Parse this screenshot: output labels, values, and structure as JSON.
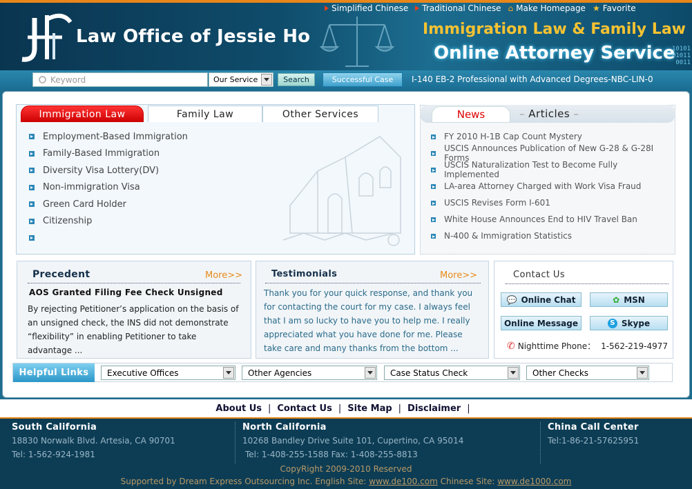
{
  "header": {
    "brand": "Law Office of  Jessie Ho",
    "top_links": [
      "Simplified Chinese",
      "Traditional Chinese",
      "Make Homepage",
      "Favorite"
    ],
    "slogan_line1": "Immigration Law & Family Law",
    "slogan_line2": "Online Attorney Service",
    "binary": "10101\n01011\n0011"
  },
  "search": {
    "placeholder": "Keyword",
    "service_select": "Our Service",
    "search_button": "Search",
    "case_button": "Successful Case",
    "ticker": "I-140 EB-2 Professional with Advanced Degrees-NBC-LIN-0"
  },
  "law_tabs": [
    "Immigration Law",
    "Family Law",
    "Other Services"
  ],
  "law_items": [
    "Employment-Based Immigration",
    "Family-Based Immigration",
    "Diversity Visa Lottery(DV)",
    "Non-immigration Visa",
    "Green Card Holder",
    "Citizenship",
    ""
  ],
  "news": {
    "tab_news": "News",
    "tab_articles": "Articles",
    "items": [
      "FY 2010 H-1B Cap Count Mystery",
      "USCIS Announces Publication of New G-28 & G-28I Forms",
      "USCIS Naturalization Test to Become Fully Implemented",
      "LA-area Attorney Charged with Work Visa Fraud",
      "USCIS Revises Form I-601",
      "White House Announces End to HIV Travel Ban",
      "N-400 & Immigration Statistics"
    ]
  },
  "precedent": {
    "title": "Precedent",
    "more": "More>>",
    "case_title": "AOS Granted Filing Fee Check Unsigned",
    "text": "By rejecting Petitioner’s application on the basis of an unsigned check, the INS did not demonstrate “flexibility” in enabling Petitioner  to take advantage ..."
  },
  "testimonials": {
    "title": "Testimonials",
    "more": "More>>",
    "text": "Thank you for your quick response, and thank you for contacting the court for my case. I always feel that I am so lucky to have you to help me. I really appreciated what you have done for me. Please take care and many thanks from the bottom ..."
  },
  "contact": {
    "title": "Contact Us",
    "online_chat": "Online Chat",
    "msn": "MSN",
    "online_message": "Online Message",
    "skype": "Skype",
    "phone_label": "Nighttime Phone：",
    "phone": "1-562-219-4977"
  },
  "helpful": {
    "label": "Helpful Links",
    "selects": [
      "Executive Offices",
      "Other Agencies",
      "Case Status Check",
      "Other Checks"
    ]
  },
  "footer_nav": [
    "About Us",
    "Contact Us",
    "Site Map",
    "Disclaimer"
  ],
  "offices": [
    {
      "name": "South California",
      "address": "18830 Norwalk Blvd. Artesia, CA 90701",
      "phone": "Tel: 1-562-924-1981"
    },
    {
      "name": "North California",
      "address": "10268 Bandley Drive Suite 101, Cupertino, CA 95014",
      "phone": "Tel: 1-408-255-1588  Fax: 1-408-255-8813"
    },
    {
      "name": "China Call Center",
      "address": "Tel:1-86-21-57625951",
      "phone": ""
    }
  ],
  "copyright": "CopyRight 2009-2010 Reserved",
  "support": {
    "prefix": "Supported by Dream Express Outsourcing Inc. English Site: ",
    "en_site": "www.de100.com",
    "mid": " Chinese Site: ",
    "cn_site": "www.de1000.com"
  },
  "colors": {
    "accent_orange": "#e8861a",
    "header_blue": "#0f4c6b",
    "active_tab_red": "#e02020",
    "slogan_gold": "#f5c232"
  }
}
